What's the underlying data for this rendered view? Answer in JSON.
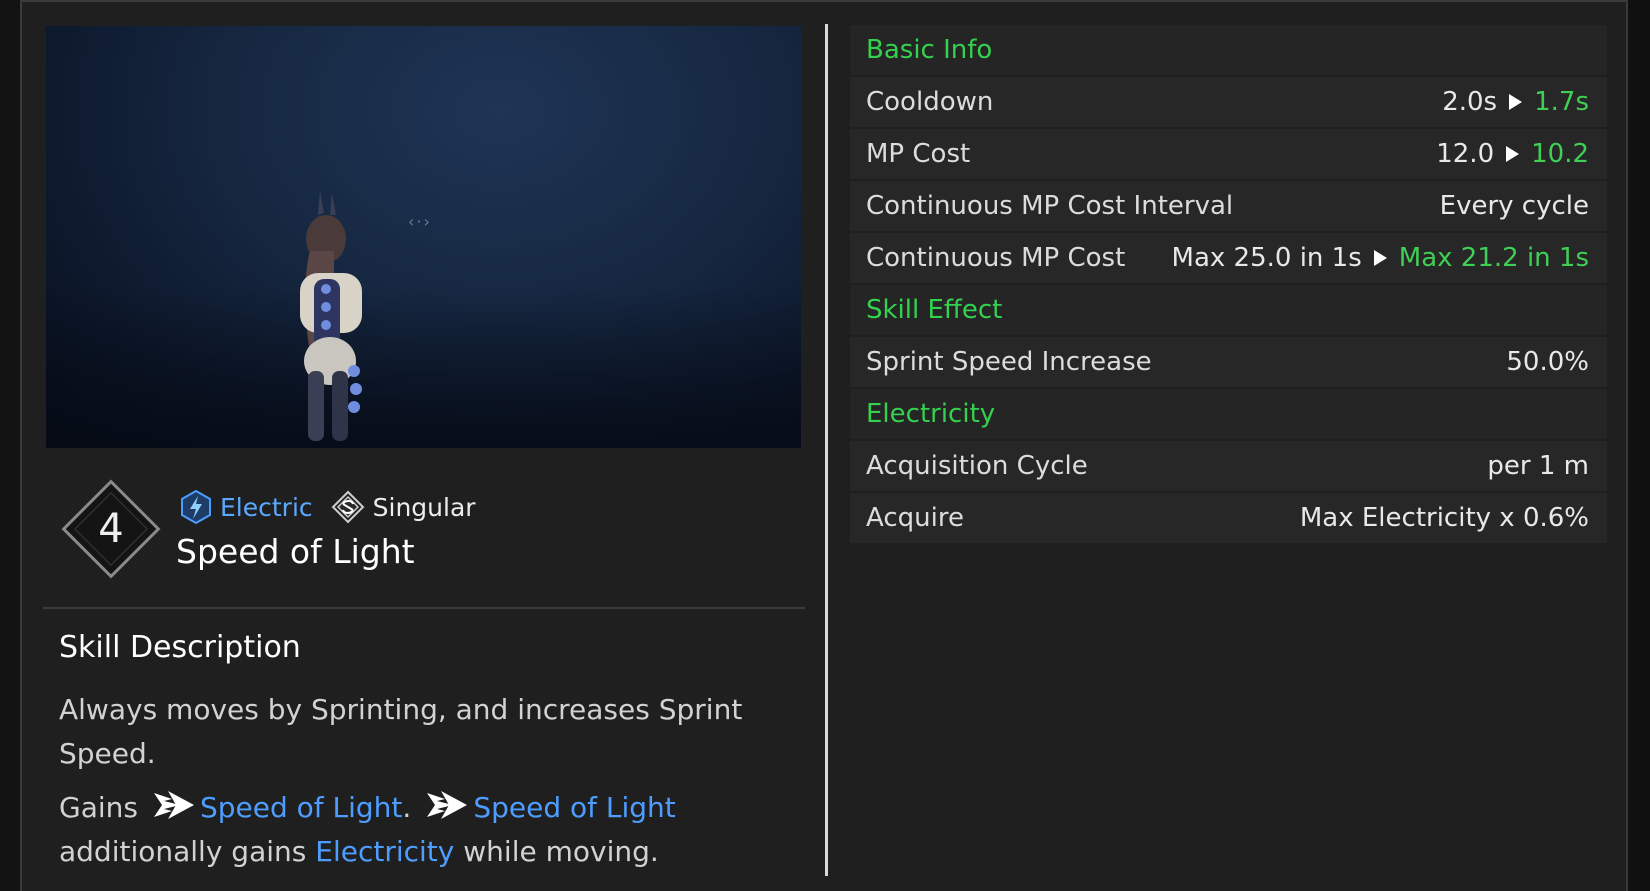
{
  "preview": {
    "drag_hint": "‹·›"
  },
  "skill": {
    "rank": "4",
    "tags": [
      {
        "label": "Electric",
        "icon": "electric-bolt-icon",
        "color": "#5aa9ff"
      },
      {
        "label": "Singular",
        "icon": "singular-emblem-icon",
        "color": "#ececec"
      }
    ],
    "name": "Speed of Light"
  },
  "description": {
    "title": "Skill Description",
    "line1": "Always moves by Sprinting, and increases Sprint Speed.",
    "gains_prefix": "Gains",
    "buff_name": "Speed of Light",
    "buff_name_2": "Speed of Light",
    "period": ".",
    "additional_prefix": "additionally gains",
    "electricity": "Electricity",
    "suffix": "while moving.",
    "buff_icon": "sprint-arrow-icon"
  },
  "stats": {
    "basic_info": "Basic Info",
    "cooldown": {
      "label": "Cooldown",
      "old": "2.0s",
      "new": "1.7s"
    },
    "mp_cost": {
      "label": "MP Cost",
      "old": "12.0",
      "new": "10.2"
    },
    "mp_interval": {
      "label": "Continuous MP Cost Interval",
      "value": "Every cycle"
    },
    "mp_continuous": {
      "label": "Continuous MP Cost",
      "old": "Max 25.0 in 1s",
      "new": "Max 21.2 in 1s"
    },
    "skill_effect": "Skill Effect",
    "sprint": {
      "label": "Sprint Speed Increase",
      "value": "50.0%"
    },
    "electricity": "Electricity",
    "acq_cycle": {
      "label": "Acquisition Cycle",
      "value": "per 1 m"
    },
    "acquire": {
      "label": "Acquire",
      "value": "Max Electricity x 0.6%"
    }
  },
  "colors": {
    "section": "#33d14e",
    "upgrade": "#3fcf55",
    "highlight": "#4d9dff"
  }
}
